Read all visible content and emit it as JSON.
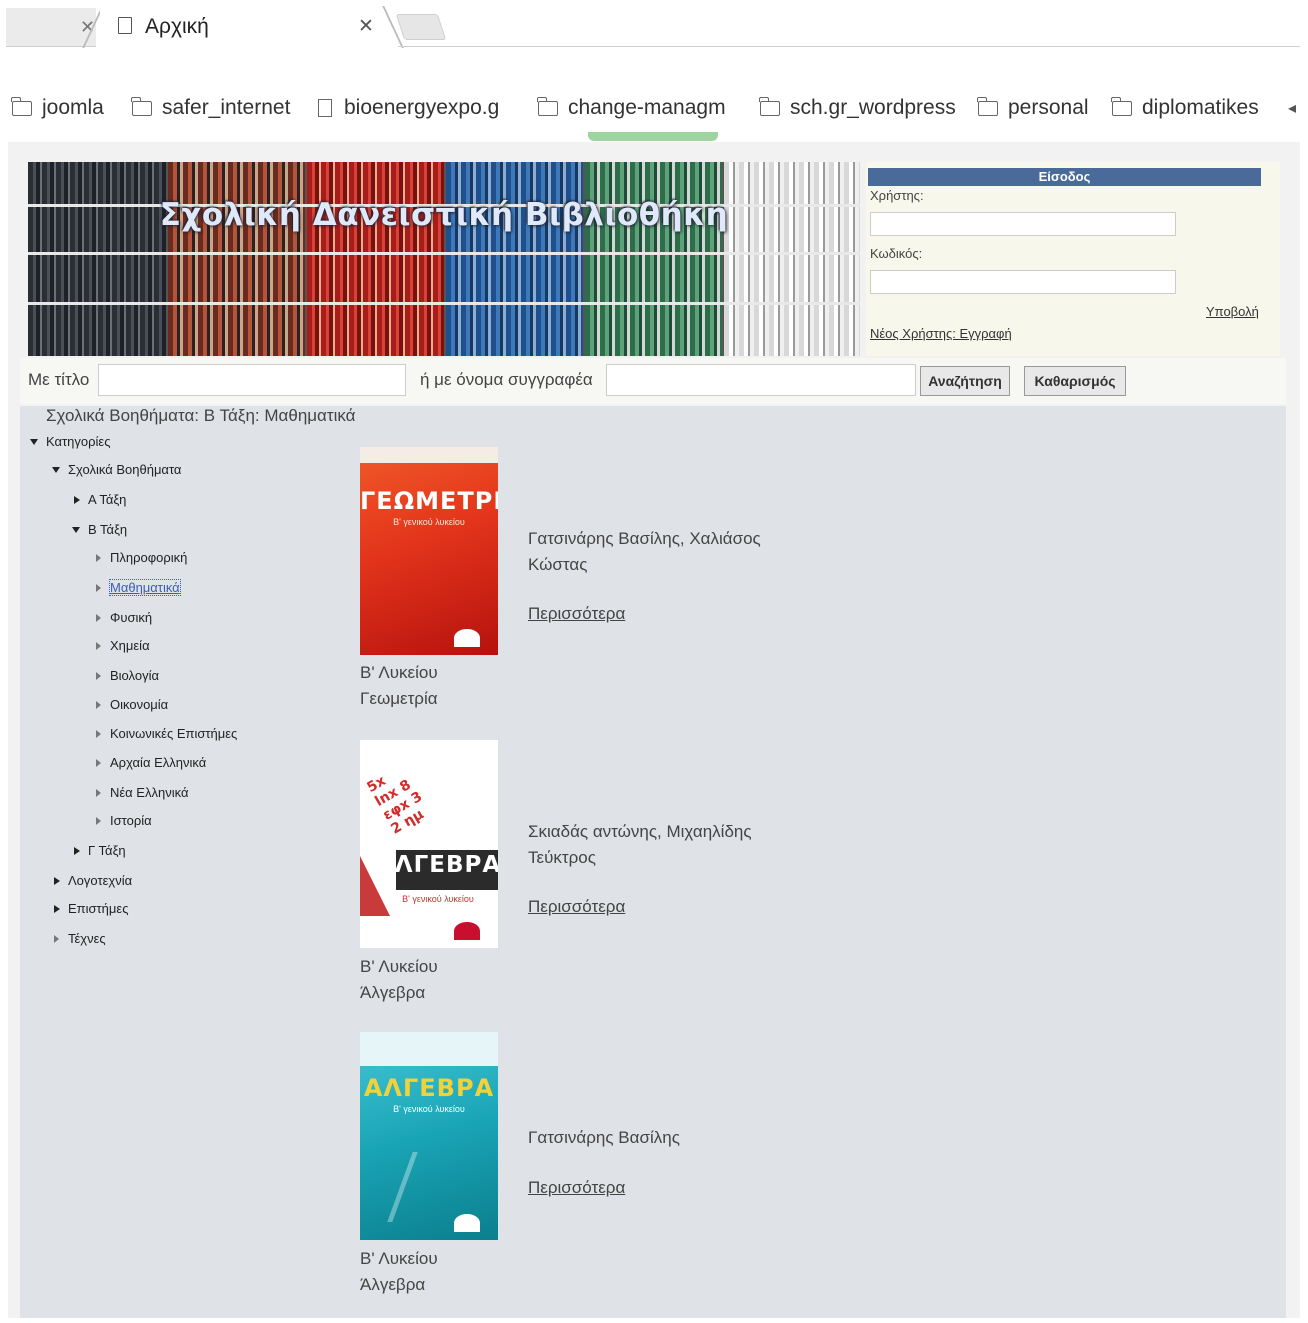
{
  "browser": {
    "active_tab_title": "Αρχική",
    "bookmarks": [
      {
        "label": "joomla",
        "type": "folder"
      },
      {
        "label": "safer_internet",
        "type": "folder"
      },
      {
        "label": "bioenergyexpo.g",
        "type": "page"
      },
      {
        "label": "change-managm",
        "type": "folder"
      },
      {
        "label": "sch.gr_wordpress",
        "type": "folder"
      },
      {
        "label": "personal",
        "type": "folder"
      },
      {
        "label": "diplomatikes",
        "type": "folder"
      }
    ]
  },
  "header": {
    "banner_title": "Σχολική Δανειστική Βιβλιοθήκη"
  },
  "login": {
    "title": "Είσοδος",
    "username_label": "Χρήστης:",
    "password_label": "Κωδικός:",
    "submit_label": "Υποβολή",
    "register_label": "Νέος Χρήστης: Εγγραφή"
  },
  "search": {
    "title_label": "Με τίτλο",
    "author_label": "ή με όνομα συγγραφέα",
    "search_button": "Αναζήτηση",
    "clear_button": "Καθαρισμός"
  },
  "breadcrumb": "Σχολικά Βοηθήματα: Β Τάξη: Μαθηματικά",
  "tree": {
    "root": "Κατηγορίες",
    "school_aids": "Σχολικά Βοηθήματα",
    "grade_a": "Α Τάξη",
    "grade_b": "Β Τάξη",
    "subjects": [
      "Πληροφορική",
      "Μαθηματικά",
      "Φυσική",
      "Χημεία",
      "Βιολογία",
      "Οικονομία",
      "Κοινωνικές Επιστήμες",
      "Αρχαία Ελληνικά",
      "Νέα Ελληνικά",
      "Ιστορία"
    ],
    "grade_c": "Γ Τάξη",
    "literature": "Λογοτεχνία",
    "sciences": "Επιστήμες",
    "arts": "Τέχνες"
  },
  "books": [
    {
      "cover_title": "ΓΕΩΜΕΤΡΙΑ",
      "cover_subtitle": "Β' γενικού λυκείου",
      "level": "Β' Λυκείου",
      "title": "Γεωμετρία",
      "author_line1": "Γατσινάρης Βασίλης, Χαλιάσος",
      "author_line2": "Κώστας",
      "more": "Περισσότερα"
    },
    {
      "cover_title": "ΑΛΓΕΒΡΑ",
      "cover_subtitle": "Β' γενικού λυκείου",
      "level": "Β' Λυκείου",
      "title": "Άλγεβρα",
      "author_line1": "Σκιαδάς αντώνης, Μιχαηλίδης",
      "author_line2": "Τεύκτρος",
      "more": "Περισσότερα"
    },
    {
      "cover_title": "ΑΛΓΕΒΡΑ",
      "cover_subtitle": "Β' γενικού λυκείου",
      "level": "Β' Λυκείου",
      "title": "Άλγεβρα",
      "author_line1": "Γατσινάρης Βασίλης",
      "author_line2": "",
      "more": "Περισσότερα"
    }
  ]
}
